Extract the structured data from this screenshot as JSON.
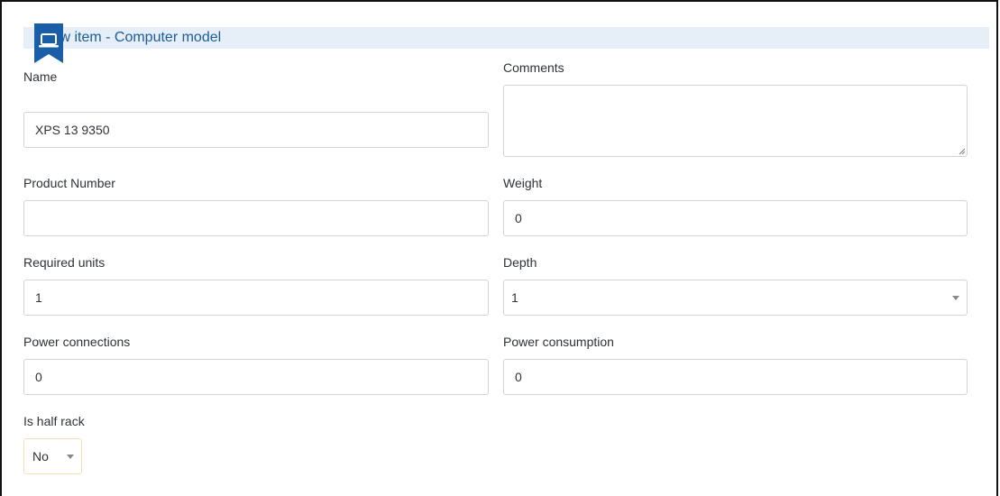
{
  "header": {
    "title": "New item - Computer model",
    "icon": "laptop-icon",
    "accent_color": "#1b5ea8",
    "bar_color": "#e6eef7"
  },
  "fields": {
    "name": {
      "label": "Name",
      "value": "XPS 13 9350"
    },
    "comments": {
      "label": "Comments",
      "value": ""
    },
    "product_number": {
      "label": "Product Number",
      "value": ""
    },
    "weight": {
      "label": "Weight",
      "value": "0"
    },
    "required_units": {
      "label": "Required units",
      "value": "1"
    },
    "depth": {
      "label": "Depth",
      "value": "1"
    },
    "power_connections": {
      "label": "Power connections",
      "value": "0"
    },
    "power_consumption": {
      "label": "Power consumption",
      "value": "0"
    },
    "is_half_rack": {
      "label": "Is half rack",
      "value": "No"
    }
  }
}
